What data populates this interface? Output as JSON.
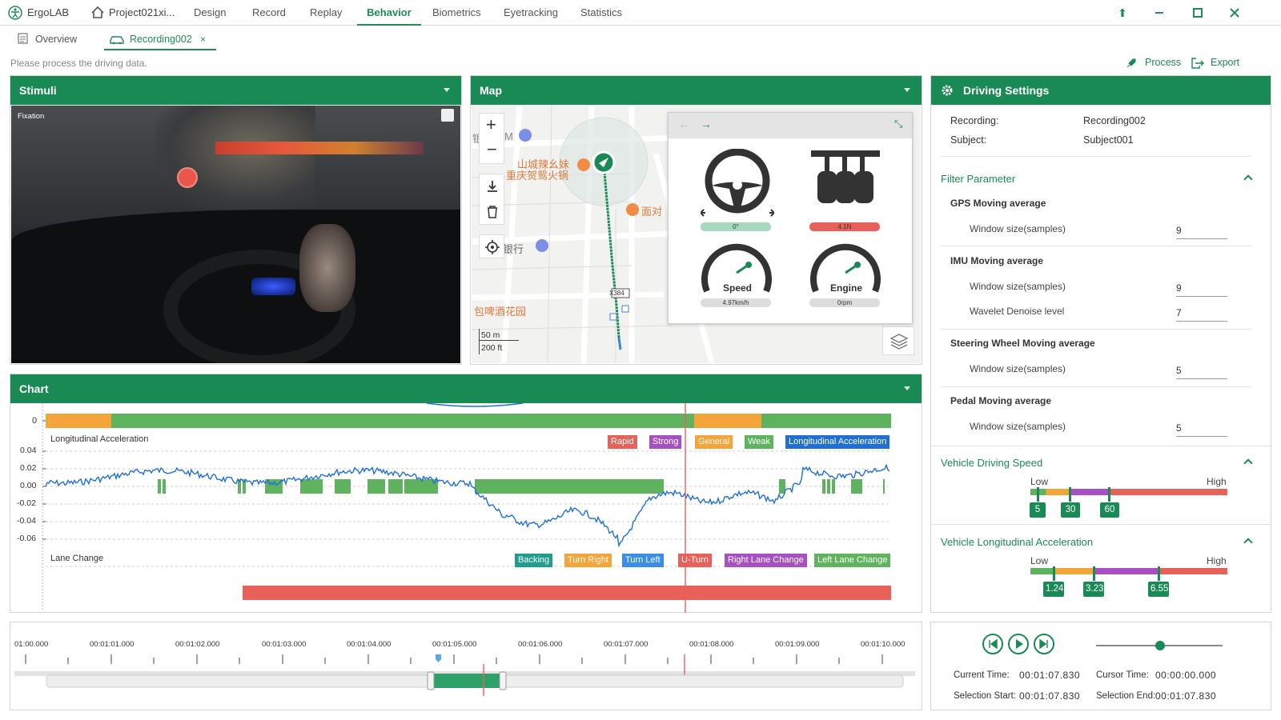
{
  "app": {
    "name": "ErgoLAB",
    "project": "Project021xi..."
  },
  "nav": [
    "Design",
    "Record",
    "Replay",
    "Behavior",
    "Biometrics",
    "Eyetracking",
    "Statistics"
  ],
  "nav_active": "Behavior",
  "tabs": {
    "overview": "Overview",
    "recording": "Recording002"
  },
  "status_text": "Please process the driving data.",
  "actions": {
    "process": "Process",
    "export": "Export"
  },
  "stimuli": {
    "title": "Stimuli",
    "overlay_label": "Fixation"
  },
  "map": {
    "title": "Map",
    "scale_m": "50 m",
    "scale_ft": "200 ft",
    "poi": [
      "山城辣幺妹",
      "重庆贺鸳火锅",
      "面对",
      "银行",
      "包啤酒花园",
      "X384",
      "M",
      "银"
    ]
  },
  "dashboard": {
    "steering": "0°",
    "pedal": "4.1N",
    "speed_label": "Speed",
    "speed_value": "4.97km/h",
    "engine_label": "Engine",
    "engine_value": "0rpm"
  },
  "settings": {
    "title": "Driving Settings",
    "recording_label": "Recording:",
    "recording_value": "Recording002",
    "subject_label": "Subject:",
    "subject_value": "Subject001",
    "filter_title": "Filter Parameter",
    "gps_title": "GPS Moving average",
    "gps_window_label": "Window size(samples)",
    "gps_window": "9",
    "imu_title": "IMU Moving average",
    "imu_window_label": "Window size(samples)",
    "imu_window": "9",
    "imu_wavelet_label": "Wavelet Denoise level",
    "imu_wavelet": "7",
    "steer_title": "Steering Wheel Moving average",
    "steer_window_label": "Window size(samples)",
    "steer_window": "5",
    "pedal_title": "Pedal Moving average",
    "pedal_window_label": "Window size(samples)",
    "pedal_window": "5",
    "speed_title": "Vehicle Driving Speed",
    "speed_low": "Low",
    "speed_high": "High",
    "speed_marks": [
      "5",
      "30",
      "60"
    ],
    "accel_title": "Vehicle Longitudinal Acceleration",
    "accel_low": "Low",
    "accel_high": "High",
    "accel_marks": [
      "1.24",
      "3.23",
      "6.55"
    ]
  },
  "chart": {
    "title": "Chart",
    "row0_label": "0",
    "accel_label": "Longitudinal Acceleration",
    "lane_label": "Lane Change",
    "yticks": [
      "0.04",
      "0.02",
      "0.00",
      "-0.02",
      "-0.04",
      "-0.06"
    ],
    "legend_accel": [
      "Rapid",
      "Strong",
      "General",
      "Weak",
      "Longitudinal Acceleration"
    ],
    "legend_lane": [
      "Backing",
      "Turn Right",
      "Turn Left",
      "U-Turn",
      "Right Lane Change",
      "Left Lane Change"
    ]
  },
  "timeline": {
    "ticks": [
      "01:00.000",
      "00:01:01.000",
      "00:01:02.000",
      "00:01:03.000",
      "00:01:04.000",
      "00:01:05.000",
      "00:01:06.000",
      "00:01:07.000",
      "00:01:08.000",
      "00:01:09.000",
      "00:01:10.000"
    ]
  },
  "playback": {
    "current_time_label": "Current Time:",
    "current_time": "00:01:07.830",
    "cursor_time_label": "Cursor Time:",
    "cursor_time": "00:00:00.000",
    "sel_start_label": "Selection Start:",
    "sel_start": "00:01:07.830",
    "sel_end_label": "Selection End:",
    "sel_end": "00:01:07.830"
  },
  "colors": {
    "accent": "#1a8a55",
    "rapid": "#e8605a",
    "strong": "#a84fc4",
    "general": "#f4a53a",
    "weak": "#5fb35f",
    "accel_line": "#1f6fd6",
    "backing": "#1f9e8f",
    "turn_left": "#3a8ee6",
    "u_turn": "#e8605a",
    "right_lane": "#a84fc4",
    "left_lane": "#5fb35f"
  }
}
